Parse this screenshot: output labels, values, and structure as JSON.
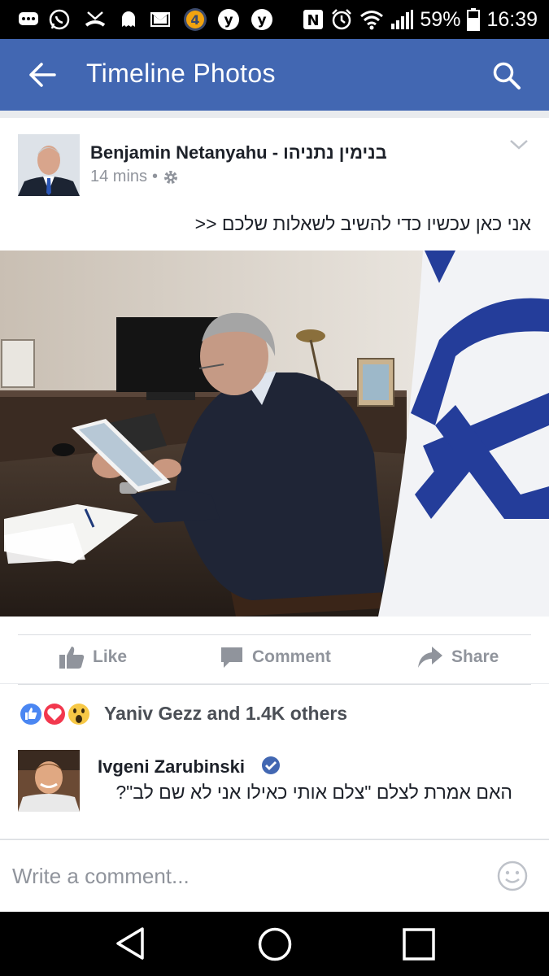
{
  "status_bar": {
    "battery": "59%",
    "time": "16:39",
    "notification_icons": [
      "chat-icon",
      "whatsapp-icon",
      "missed-call-icon",
      "ghost-icon",
      "gmail-icon",
      "channel4-icon",
      "ynet-icon",
      "ynet-icon"
    ],
    "system_icons": [
      "nfc-icon",
      "alarm-icon",
      "wifi-icon",
      "signal-icon",
      "battery-icon"
    ]
  },
  "app_bar": {
    "title": "Timeline Photos",
    "back_icon": "back-arrow-icon",
    "search_icon": "search-icon"
  },
  "post": {
    "author": "Benjamin Netanyahu - בנימין נתניהו",
    "time": "14 mins",
    "privacy_icon": "gear-icon",
    "text": "אני כאן עכשיו כדי להשיב לשאלות שלכם <<"
  },
  "actions": {
    "like": "Like",
    "comment": "Comment",
    "share": "Share"
  },
  "reactions": {
    "text": "Yaniv Gezz and 1.4K others",
    "icons": [
      "like-reaction-icon",
      "love-reaction-icon",
      "wow-reaction-icon"
    ]
  },
  "comment": {
    "author": "Ivgeni Zarubinski",
    "text": "האם אמרת לצלם \"צלם אותי כאילו אני לא שם לב\"?"
  },
  "composer": {
    "placeholder": "Write a comment..."
  },
  "colors": {
    "brand": "#4267b2",
    "text": "#1d2129",
    "secondary": "#90949c",
    "verified": "#4267b2"
  }
}
